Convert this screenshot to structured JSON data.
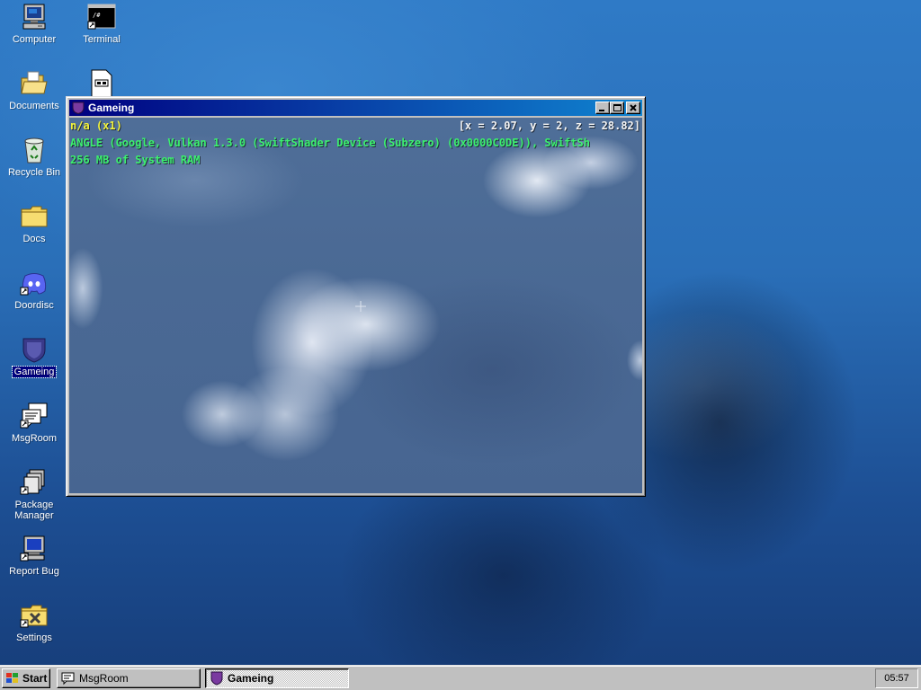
{
  "desktop": {
    "icons": [
      {
        "label": "Computer",
        "icon": "computer-icon"
      },
      {
        "label": "Terminal",
        "icon": "terminal-icon"
      },
      {
        "label": "Documents",
        "icon": "folder-open-icon"
      },
      {
        "label": "",
        "icon": "document-file-icon"
      },
      {
        "label": "Recycle Bin",
        "icon": "recycle-bin-icon"
      },
      {
        "label": "Docs",
        "icon": "folder-icon"
      },
      {
        "label": "Doordisc",
        "icon": "discord-icon"
      },
      {
        "label": "Gameing",
        "icon": "gameing-icon"
      },
      {
        "label": "MsgRoom",
        "icon": "msgroom-icon"
      },
      {
        "label": "Package Manager",
        "icon": "package-manager-icon"
      },
      {
        "label": "Report Bug",
        "icon": "report-bug-icon"
      },
      {
        "label": "Settings",
        "icon": "settings-icon"
      }
    ]
  },
  "window": {
    "title": "Gameing",
    "hud": {
      "fps": "n/a (x1)",
      "coords": "[x = 2.07, y = 2, z = 28.82]",
      "renderer": "ANGLE (Google, Vulkan 1.3.0 (SwiftShader Device (Subzero) (0x0000C0DE)), SwiftSh",
      "memory": "256 MB of System RAM"
    }
  },
  "taskbar": {
    "start_label": "Start",
    "tasks": [
      {
        "label": "MsgRoom",
        "active": false
      },
      {
        "label": "Gameing",
        "active": true
      }
    ],
    "clock": "05:57"
  },
  "colors": {
    "titlebar_start": "#000080",
    "titlebar_end": "#1084d0",
    "hud_yellow": "#f2f23c",
    "hud_green": "#3cf06e",
    "chrome": "#c0c0c0"
  }
}
